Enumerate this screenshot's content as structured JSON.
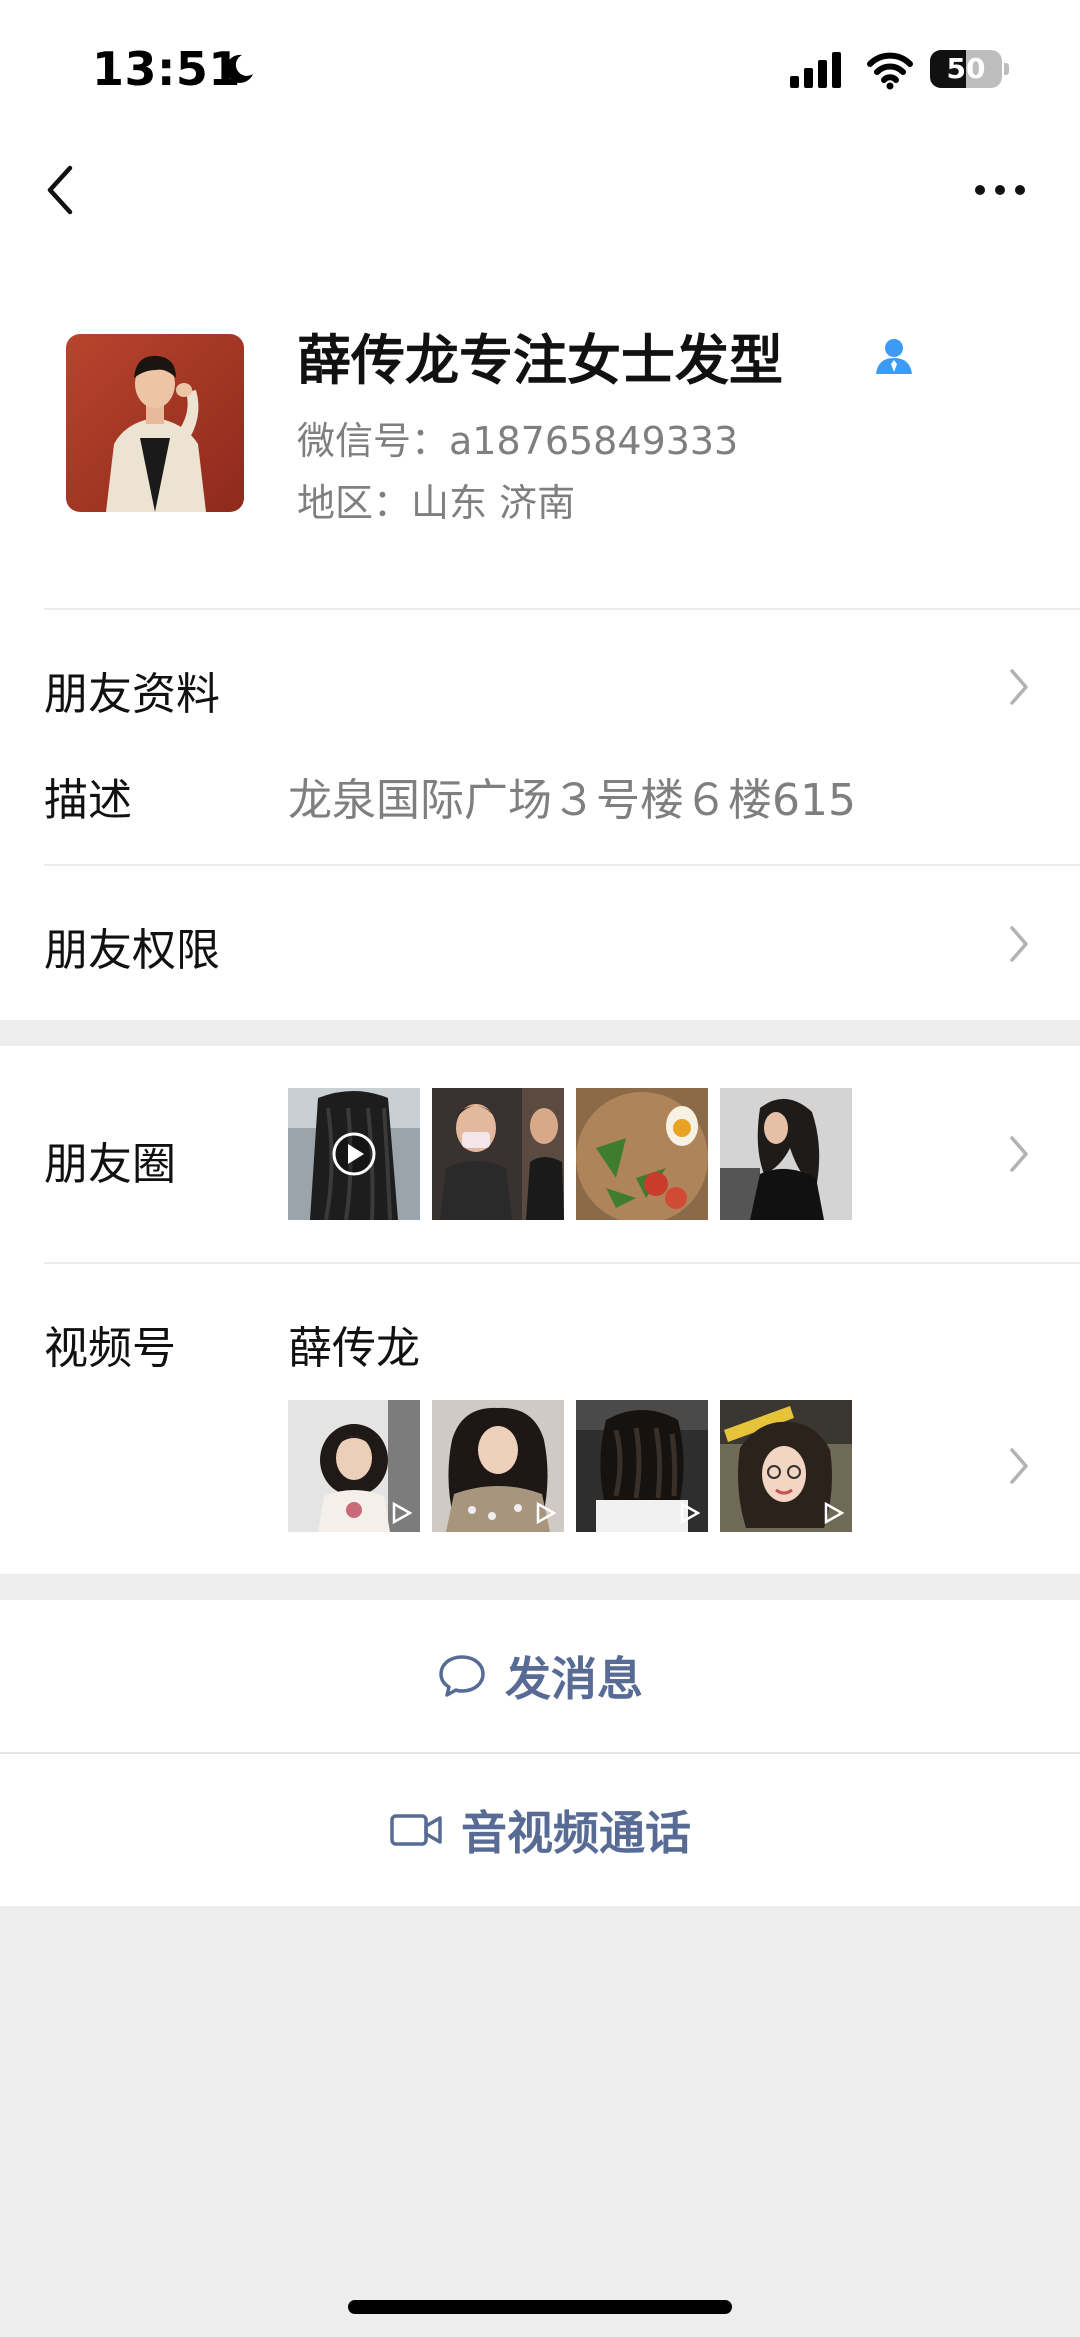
{
  "status_bar": {
    "time": "13:51",
    "battery_level": "50",
    "battery_fraction": 0.5,
    "icons": [
      "moon-icon",
      "signal-icon",
      "wifi-icon",
      "battery-icon"
    ]
  },
  "nav": {
    "back_icon": "chevron-left-icon",
    "more_icon": "more-dots-icon"
  },
  "profile": {
    "name": "薛传龙专注女士发型",
    "wechat_id": "微信号：a18765849333",
    "region": "地区：山东 济南"
  },
  "friend_info": {
    "label": "朋友资料",
    "description_label": "描述",
    "description_value": "龙泉国际广场３号楼６楼615"
  },
  "permissions": {
    "label": "朋友权限"
  },
  "moments": {
    "label": "朋友圈"
  },
  "channels": {
    "label": "视频号",
    "name": "薛传龙"
  },
  "actions": {
    "message": "发消息",
    "call": "音视频通话"
  },
  "colors": {
    "link": "#576b95",
    "verified": "#3d9bf5",
    "background": "#ededed"
  }
}
